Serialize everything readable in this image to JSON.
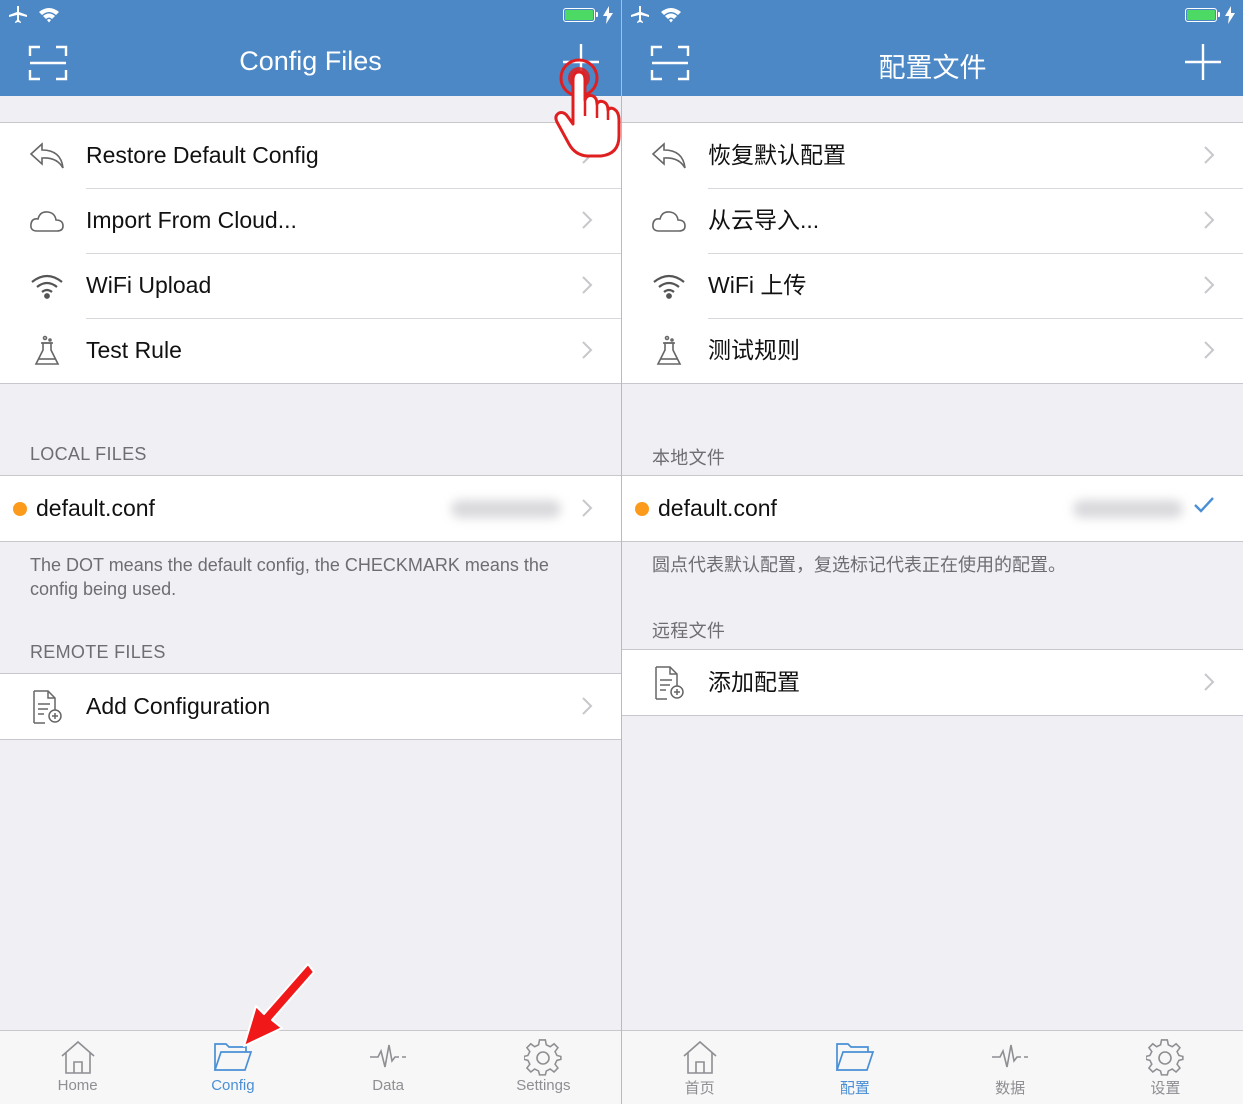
{
  "colors": {
    "nav_bar": "#4c88c6",
    "accent": "#4a8fd6",
    "default_dot": "#fb9a1b",
    "battery": "#4cd964"
  },
  "left": {
    "nav": {
      "title": "Config Files"
    },
    "menu": [
      {
        "label": "Restore Default Config",
        "icon": "undo-arrow-icon"
      },
      {
        "label": "Import From Cloud...",
        "icon": "cloud-icon"
      },
      {
        "label": "WiFi Upload",
        "icon": "wifi-icon"
      },
      {
        "label": "Test Rule",
        "icon": "flask-icon"
      }
    ],
    "local_header": "LOCAL FILES",
    "local_file": {
      "name": "default.conf"
    },
    "footer": "The DOT means the default config, the CHECKMARK means the config being used.",
    "remote_header": "REMOTE FILES",
    "remote": {
      "label": "Add Configuration",
      "icon": "add-document-icon"
    },
    "tabs": [
      {
        "label": "Home",
        "icon": "home-icon"
      },
      {
        "label": "Config",
        "icon": "folder-icon",
        "active": true
      },
      {
        "label": "Data",
        "icon": "pulse-icon"
      },
      {
        "label": "Settings",
        "icon": "gear-icon"
      }
    ]
  },
  "right": {
    "nav": {
      "title": "配置文件"
    },
    "menu": [
      {
        "label": "恢复默认配置",
        "icon": "undo-arrow-icon"
      },
      {
        "label": "从云导入...",
        "icon": "cloud-icon"
      },
      {
        "label": "WiFi 上传",
        "icon": "wifi-icon"
      },
      {
        "label": "测试规则",
        "icon": "flask-icon"
      }
    ],
    "local_header": "本地文件",
    "local_file": {
      "name": "default.conf"
    },
    "footer": "圆点代表默认配置，复选标记代表正在使用的配置。",
    "remote_header": "远程文件",
    "remote": {
      "label": "添加配置",
      "icon": "add-document-icon"
    },
    "tabs": [
      {
        "label": "首页",
        "icon": "home-icon"
      },
      {
        "label": "配置",
        "icon": "folder-icon",
        "active": true
      },
      {
        "label": "数据",
        "icon": "pulse-icon"
      },
      {
        "label": "设置",
        "icon": "gear-icon"
      }
    ]
  }
}
